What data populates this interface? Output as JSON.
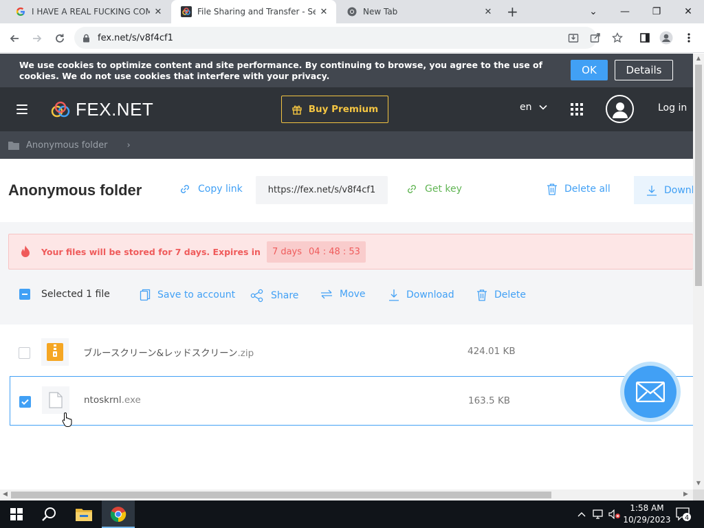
{
  "browser": {
    "tabs": [
      {
        "title": "I HAVE A REAL FUCKING COMPUTER",
        "close": "✕"
      },
      {
        "title": "File Sharing and Transfer - Send",
        "close": "✕"
      },
      {
        "title": "New Tab",
        "close": "✕"
      }
    ],
    "new_tab": "+",
    "url": "fex.net/s/v8f4cf1",
    "window_controls": {
      "list": "⌄",
      "minimize": "—",
      "restore": "❐",
      "close": "✕"
    }
  },
  "cookie": {
    "text": "We use cookies to optimize content and site performance. By continuing to browse, you agree to the use of cookies. We do not use cookies that interfere with your privacy.",
    "ok": "OK",
    "details": "Details"
  },
  "header": {
    "logo_text": "FEX.NET",
    "buy_premium": "Buy Premium",
    "language": "en",
    "login": "Log in"
  },
  "breadcrumb": {
    "folder": "Anonymous folder",
    "separator": "›"
  },
  "folder": {
    "title": "Anonymous folder",
    "copy_link": "Copy link",
    "link_value": "https://fex.net/s/v8f4cf1",
    "get_key": "Get key",
    "delete_all": "Delete all",
    "download_all": "Download all"
  },
  "expiry": {
    "text": "Your files will be stored for 7 days. Expires in",
    "days": "7 days",
    "time": "04 : 48 : 53"
  },
  "selection": {
    "count_text": "Selected 1 file",
    "actions": {
      "save": "Save to account",
      "share": "Share",
      "move": "Move",
      "download": "Download",
      "delete": "Delete"
    }
  },
  "files": [
    {
      "name": "ブルースクリーン&レッドスクリーン",
      "ext": ".zip",
      "size": "424.01 KB",
      "selected": false
    },
    {
      "name": "ntoskrnl",
      "ext": ".exe",
      "size": "163.5 KB",
      "selected": true
    }
  ],
  "taskbar": {
    "time": "1:58 AM",
    "date": "10/29/2023",
    "notifications": "4"
  },
  "colors": {
    "accent": "#41a0f5",
    "premium": "#f4c542",
    "danger": "#ef5b5b",
    "green": "#61b554",
    "header_bg": "#2f3338"
  }
}
